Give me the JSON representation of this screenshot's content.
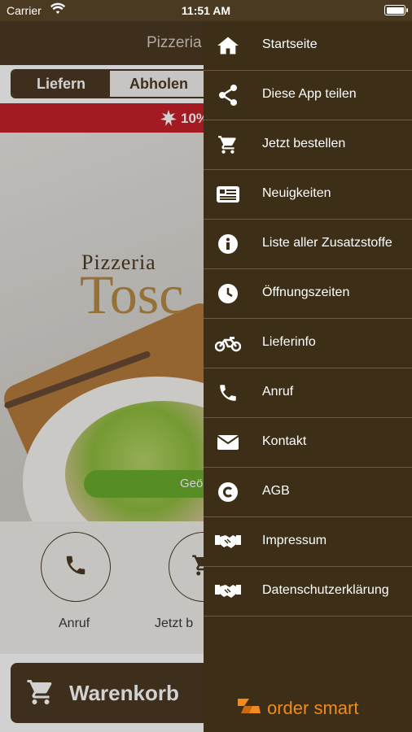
{
  "status_bar": {
    "carrier": "Carrier",
    "time": "11:51 AM",
    "battery_level": 1.0
  },
  "header": {
    "title": "Pizzeria"
  },
  "order_mode": {
    "tabs": [
      {
        "label": "Liefern",
        "selected": true
      },
      {
        "label": "Abholen",
        "selected": false
      }
    ]
  },
  "promo": {
    "text": "10%"
  },
  "hero": {
    "logo_line1": "Pizzeria",
    "logo_line2": "Tosc",
    "open_badge": "Geö"
  },
  "quick_actions": [
    {
      "label": "Anruf",
      "icon": "phone-icon"
    },
    {
      "label": "Jetzt b",
      "icon": "cart-icon"
    }
  ],
  "cart_button": {
    "label": "Warenkorb"
  },
  "menu": {
    "items": [
      {
        "label": "Startseite",
        "icon": "home-icon"
      },
      {
        "label": "Diese App teilen",
        "icon": "share-icon"
      },
      {
        "label": "Jetzt bestellen",
        "icon": "cart-icon"
      },
      {
        "label": "Neuigkeiten",
        "icon": "news-icon"
      },
      {
        "label": "Liste aller Zusatzstoffe",
        "icon": "info-icon"
      },
      {
        "label": "Öffnungszeiten",
        "icon": "clock-icon"
      },
      {
        "label": "Lieferinfo",
        "icon": "motorcycle-icon"
      },
      {
        "label": "Anruf",
        "icon": "phone-icon"
      },
      {
        "label": "Kontakt",
        "icon": "envelope-icon"
      },
      {
        "label": "AGB",
        "icon": "copyright-icon"
      },
      {
        "label": "Impressum",
        "icon": "handshake-icon"
      },
      {
        "label": "Datenschutzerklärung",
        "icon": "handshake-icon"
      }
    ],
    "brand": "order smart"
  },
  "colors": {
    "brand_brown": "#4b3a22",
    "drawer_bg": "#3d2e17",
    "promo_red": "#c8202a",
    "open_green": "#6bad2e",
    "order_smart_orange": "#f18a1f"
  }
}
